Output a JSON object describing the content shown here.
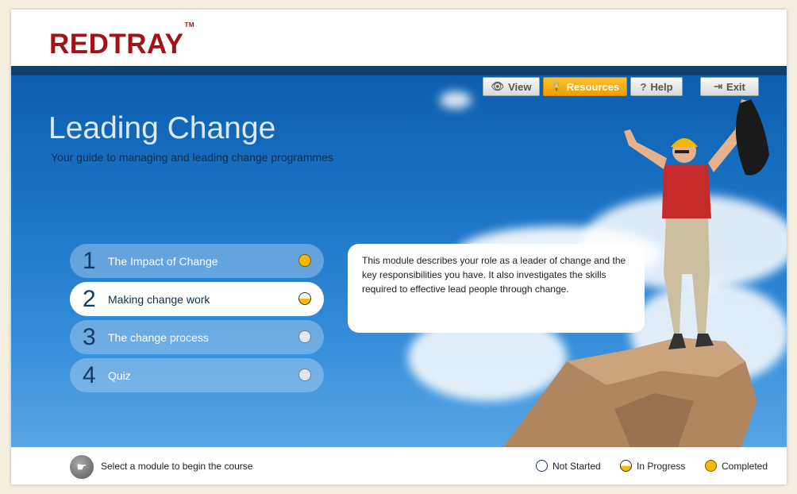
{
  "brand": {
    "name": "REDTRAY",
    "tm": "TM"
  },
  "toolbar": {
    "view": {
      "label": "View",
      "icon": "eye-icon"
    },
    "resources": {
      "label": "Resources",
      "icon": "lock-icon"
    },
    "help": {
      "label": "Help",
      "icon": "question-icon"
    },
    "exit": {
      "label": "Exit",
      "icon": "exit-icon"
    }
  },
  "course": {
    "title": "Leading Change",
    "subtitle": "Your guide to managing and leading change programmes"
  },
  "modules": [
    {
      "number": "1",
      "label": "The Impact of Change",
      "status": "completed"
    },
    {
      "number": "2",
      "label": "Making change work",
      "status": "in-progress"
    },
    {
      "number": "3",
      "label": "The change process",
      "status": "not-started"
    },
    {
      "number": "4",
      "label": "Quiz",
      "status": "not-started"
    }
  ],
  "description": "This module describes your role as a leader of change and the key responsibilities you have. It also investigates the skills required to effective lead people through change.",
  "footer": {
    "hint": "Select a module to begin the course",
    "legend": {
      "not_started": "Not Started",
      "in_progress": "In Progress",
      "completed": "Completed"
    }
  },
  "colors": {
    "brand": "#a1131a",
    "accent": "#f6b800",
    "hero": "#1d76c8",
    "navy": "#0f3f6d"
  }
}
